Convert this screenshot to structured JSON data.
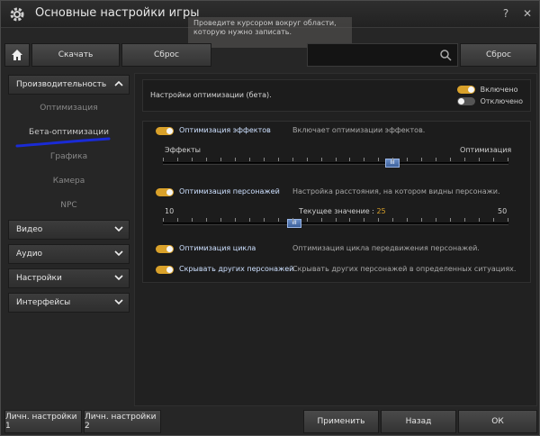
{
  "window": {
    "title": "Основные настройки игры"
  },
  "hint": {
    "line1": "Проведите курсором вокруг области,",
    "line2": "которую нужно записать."
  },
  "toolbar": {
    "download_label": "Скачать",
    "reset_label": "Сброс",
    "search_value": "",
    "search_reset_label": "Сброс"
  },
  "sidebar": {
    "performance": "Производительность",
    "sub": [
      "Оптимизация",
      "Бета-оптимизации",
      "Графика",
      "Камера",
      "NPC"
    ],
    "categories": [
      "Видео",
      "Аудио",
      "Настройки",
      "Интерфейсы"
    ]
  },
  "content": {
    "header_desc": "Настройки оптимизации (бета).",
    "legend_on": "Включено",
    "legend_off": "Отключено",
    "options": [
      {
        "label": "Оптимизация эффектов",
        "desc": "Включает оптимизации эффектов.",
        "enabled": true
      },
      {
        "label": "Оптимизация персонажей",
        "desc": "Настройка расстояния, на котором видны персонажи.",
        "enabled": true
      },
      {
        "label": "Оптимизация цикла",
        "desc": "Оптимизация цикла передвижения персонажей.",
        "enabled": true
      },
      {
        "label": "Скрывать других персонажей",
        "desc": "Скрывать других персонажей в определенных ситуациях.",
        "enabled": true
      }
    ],
    "slider1": {
      "left": "Эффекты",
      "right": "Оптимизация",
      "value_fraction": 0.67,
      "thumb": "III"
    },
    "slider2": {
      "min": "10",
      "max": "50",
      "current_label": "Текущее значение :",
      "current_value": "25",
      "value": 25,
      "thumb": "III"
    }
  },
  "footer": {
    "personal1": "Личн. настройки 1",
    "personal2": "Личн. настройки 2",
    "apply": "Применить",
    "back": "Назад",
    "ok": "ОК"
  },
  "colors": {
    "accent": "#d9a12a",
    "label_blue": "#cde0ff",
    "mark": "#1a2bd6"
  }
}
